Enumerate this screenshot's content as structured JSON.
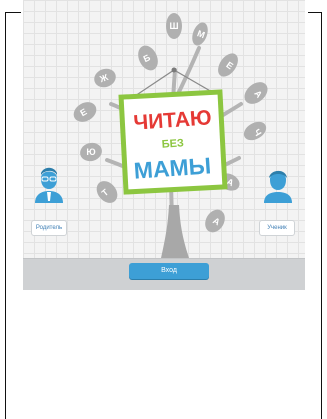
{
  "logo": {
    "line1": "ЧИТАЮ",
    "line2": "БЕЗ",
    "line3": "МАМЫ"
  },
  "leaf_letters": [
    "Ш",
    "М",
    "Б",
    "Е",
    "Ж",
    "А",
    "Е",
    "Ч",
    "Ю",
    "А",
    "Т",
    "А"
  ],
  "roles": {
    "parent_label": "Родитель",
    "student_label": "Ученик"
  },
  "footer": {
    "login_label": "Вход"
  },
  "icons": {
    "parent": "parent-avatar-icon",
    "student": "student-avatar-icon"
  },
  "colors": {
    "accent": "#3d9fd6",
    "board_frame": "#8cc640",
    "leaf": "#b0b0b0",
    "trunk": "#a4a4a4"
  }
}
